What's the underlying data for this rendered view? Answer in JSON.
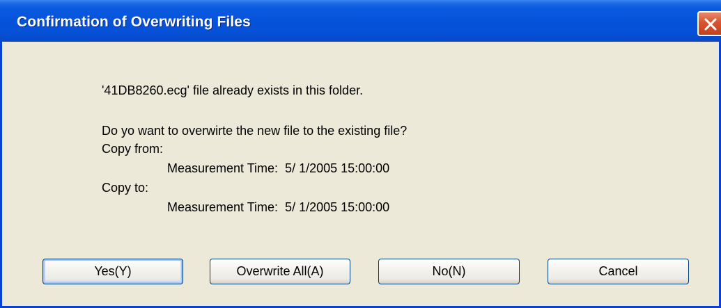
{
  "window": {
    "title": "Confirmation of Overwriting Files"
  },
  "message": {
    "line1": "'41DB8260.ecg' file already exists in this folder.",
    "line2": "Do yo want to overwirte the new file to the existing file?",
    "copy_from_label": "Copy from:",
    "copy_from_value": "Measurement Time:  5/ 1/2005 15:00:00",
    "copy_to_label": "Copy to:",
    "copy_to_value": "Measurement Time:  5/ 1/2005 15:00:00"
  },
  "buttons": {
    "yes": "Yes(Y)",
    "overwrite_all": "Overwrite All(A)",
    "no": "No(N)",
    "cancel": "Cancel"
  },
  "icons": {
    "close": "close-icon"
  },
  "colors": {
    "titlebar": "#0553DA",
    "close_button": "#D9532E",
    "background": "#ECE9D8"
  }
}
